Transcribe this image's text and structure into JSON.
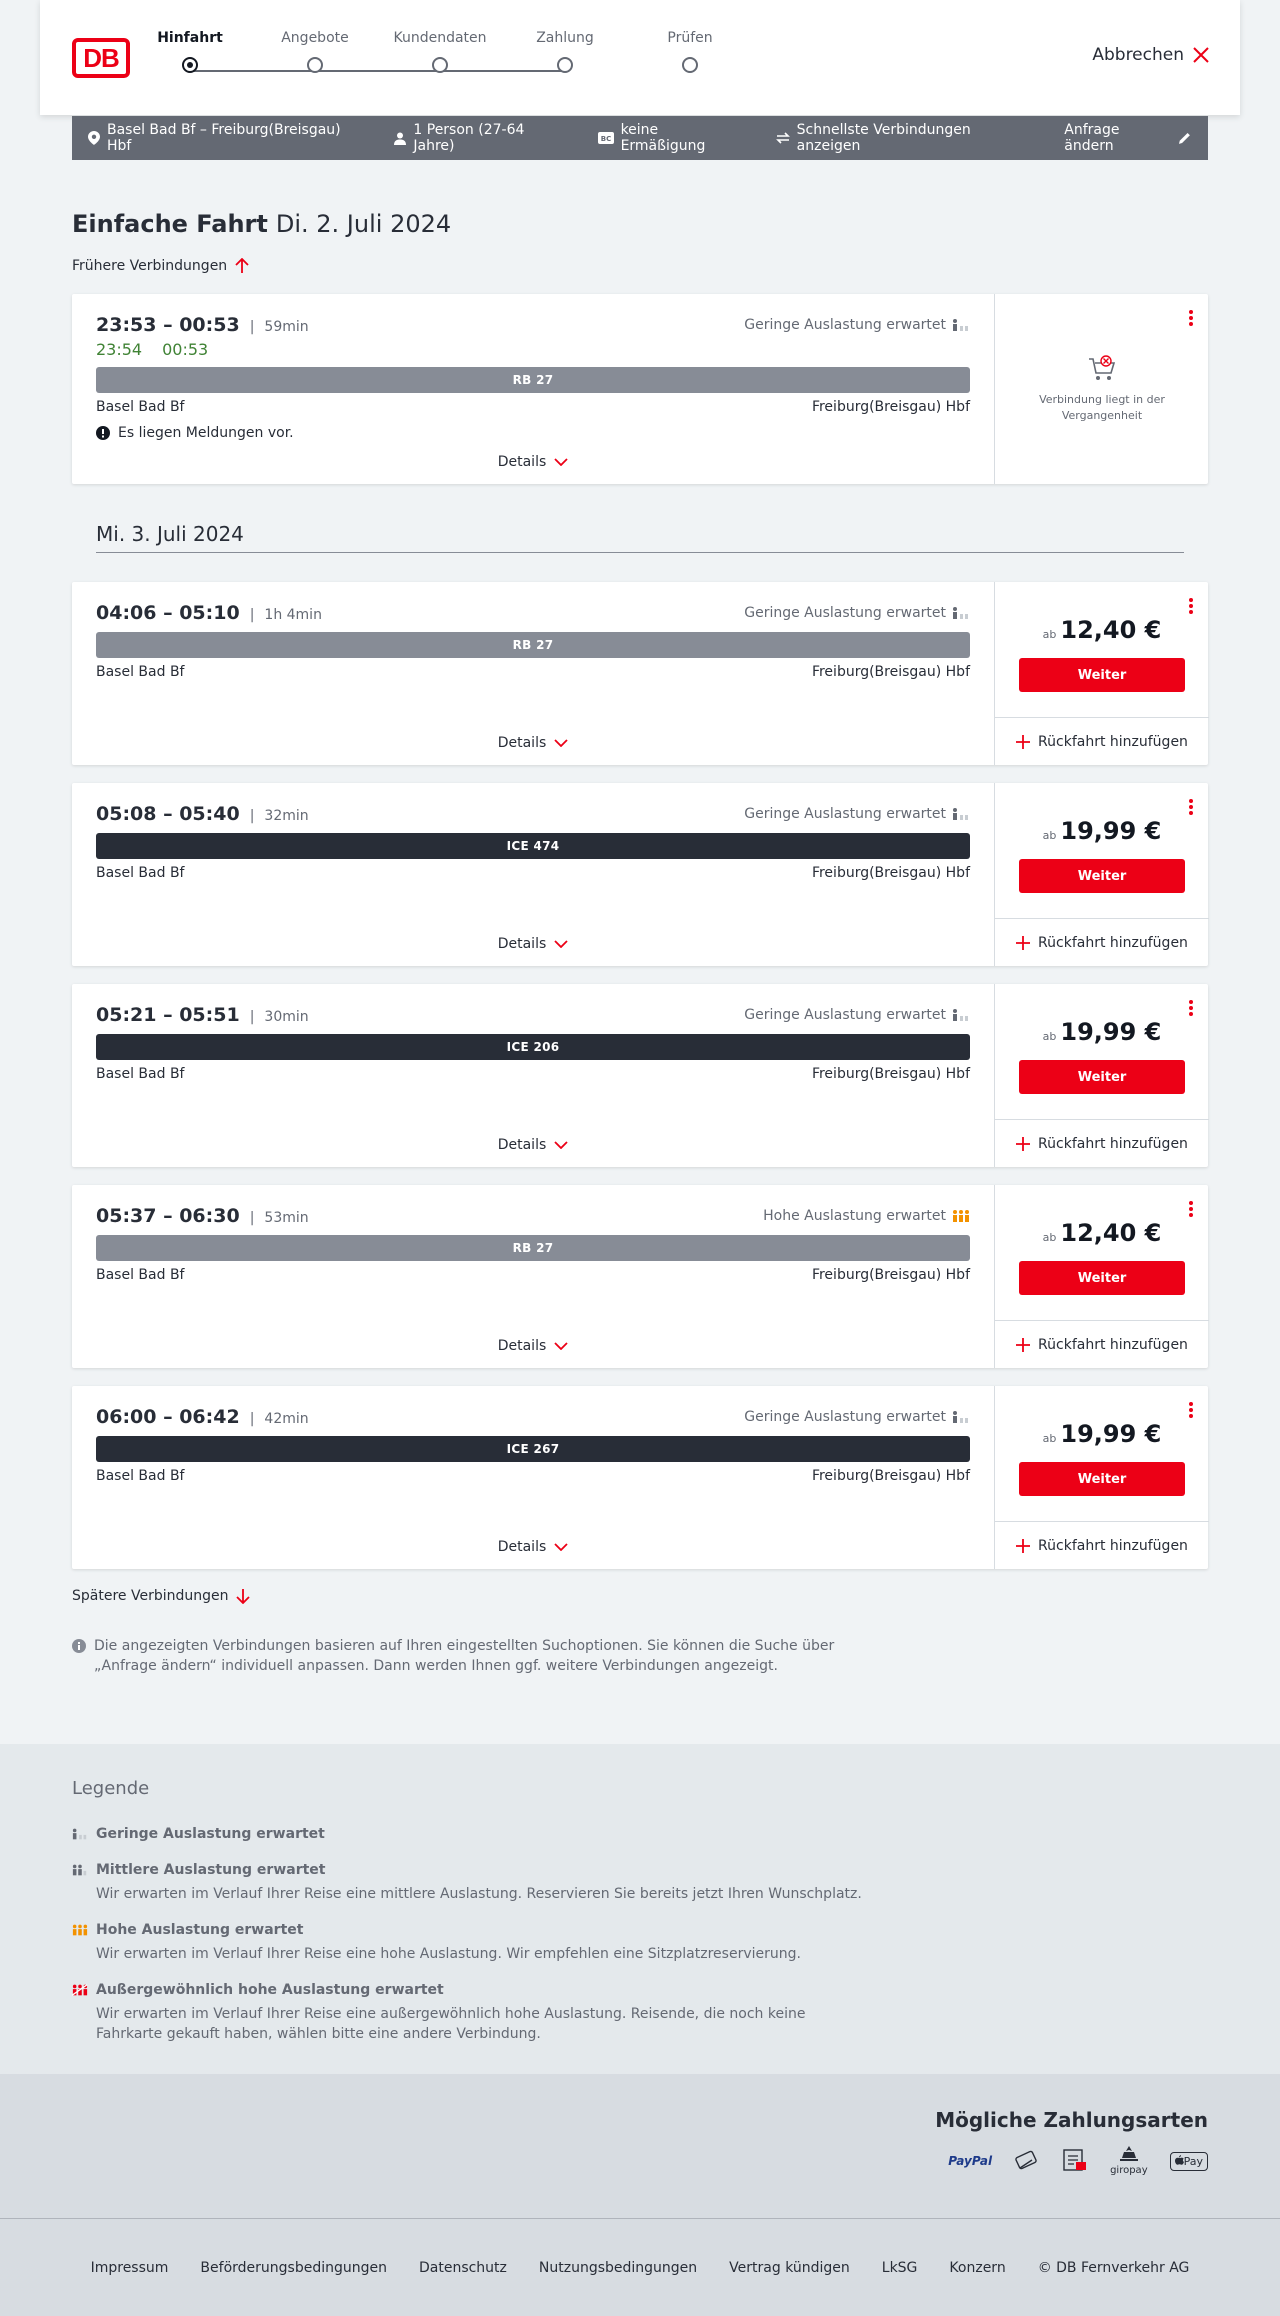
{
  "header": {
    "logo_text": "DB",
    "steps": [
      {
        "label": "Hinfahrt",
        "active": true
      },
      {
        "label": "Angebote",
        "active": false
      },
      {
        "label": "Kundendaten",
        "active": false
      },
      {
        "label": "Zahlung",
        "active": false
      },
      {
        "label": "Prüfen",
        "active": false
      }
    ],
    "cancel_label": "Abbrechen"
  },
  "summary": {
    "route": "Basel Bad Bf – Freiburg(Breisgau) Hbf",
    "passengers": "1 Person (27-64 Jahre)",
    "discount": "keine Ermäßigung",
    "fastest": "Schnellste Verbindungen anzeigen",
    "edit": "Anfrage ändern"
  },
  "title": {
    "main": "Einfache Fahrt",
    "date": "Di. 2. Juli 2024"
  },
  "earlier_label": "Frühere Verbindungen",
  "later_label": "Spätere Verbindungen",
  "day2_heading": "Mi. 3. Juli 2024",
  "connections": [
    {
      "times": "23:53 – 00:53",
      "duration": "59min",
      "realtime_dep": "23:54",
      "realtime_arr": "00:53",
      "load": "Geringe Auslastung erwartet",
      "load_level": "low",
      "train": "RB 27",
      "train_type": "regional",
      "from": "Basel Bad Bf",
      "to": "Freiburg(Breisgau) Hbf",
      "notice": "Es liegen Meldungen vor.",
      "past_msg": "Verbindung liegt in der Vergangenheit",
      "details": "Details"
    },
    {
      "times": "04:06 – 05:10",
      "duration": "1h 4min",
      "load": "Geringe Auslastung erwartet",
      "load_level": "low",
      "train": "RB 27",
      "train_type": "regional",
      "from": "Basel Bad Bf",
      "to": "Freiburg(Breisgau) Hbf",
      "price_prefix": "ab",
      "price": "12,40 €",
      "button": "Weiter",
      "return": "Rückfahrt hinzufügen",
      "details": "Details"
    },
    {
      "times": "05:08 – 05:40",
      "duration": "32min",
      "load": "Geringe Auslastung erwartet",
      "load_level": "low",
      "train": "ICE 474",
      "train_type": "ice",
      "from": "Basel Bad Bf",
      "to": "Freiburg(Breisgau) Hbf",
      "price_prefix": "ab",
      "price": "19,99 €",
      "button": "Weiter",
      "return": "Rückfahrt hinzufügen",
      "details": "Details"
    },
    {
      "times": "05:21 – 05:51",
      "duration": "30min",
      "load": "Geringe Auslastung erwartet",
      "load_level": "low",
      "train": "ICE 206",
      "train_type": "ice",
      "from": "Basel Bad Bf",
      "to": "Freiburg(Breisgau) Hbf",
      "price_prefix": "ab",
      "price": "19,99 €",
      "button": "Weiter",
      "return": "Rückfahrt hinzufügen",
      "details": "Details"
    },
    {
      "times": "05:37 – 06:30",
      "duration": "53min",
      "load": "Hohe Auslastung erwartet",
      "load_level": "high",
      "train": "RB 27",
      "train_type": "regional",
      "from": "Basel Bad Bf",
      "to": "Freiburg(Breisgau) Hbf",
      "price_prefix": "ab",
      "price": "12,40 €",
      "button": "Weiter",
      "return": "Rückfahrt hinzufügen",
      "details": "Details"
    },
    {
      "times": "06:00 – 06:42",
      "duration": "42min",
      "load": "Geringe Auslastung erwartet",
      "load_level": "low",
      "train": "ICE 267",
      "train_type": "ice",
      "from": "Basel Bad Bf",
      "to": "Freiburg(Breisgau) Hbf",
      "price_prefix": "ab",
      "price": "19,99 €",
      "button": "Weiter",
      "return": "Rückfahrt hinzufügen",
      "details": "Details"
    }
  ],
  "info_text": "Die angezeigten Verbindungen basieren auf Ihren eingestellten Suchoptionen. Sie können die Suche über „Anfrage ändern“ individuell anpassen. Dann werden Ihnen ggf. weitere Verbindungen angezeigt.",
  "legend": {
    "title": "Legende",
    "items": [
      {
        "heading": "Geringe Auslastung erwartet",
        "text": "",
        "level": "low"
      },
      {
        "heading": "Mittlere Auslastung erwartet",
        "text": "Wir erwarten im Verlauf Ihrer Reise eine mittlere Auslastung. Reservieren Sie bereits jetzt Ihren Wunschplatz.",
        "level": "medium"
      },
      {
        "heading": "Hohe Auslastung erwartet",
        "text": "Wir erwarten im Verlauf Ihrer Reise eine hohe Auslastung. Wir empfehlen eine Sitzplatzreservierung.",
        "level": "high"
      },
      {
        "heading": "Außergewöhnlich hohe Auslastung erwartet",
        "text": "Wir erwarten im Verlauf Ihrer Reise eine außergewöhnlich hohe Auslastung. Reisende, die noch keine Fahrkarte gekauft haben, wählen bitte eine andere Verbindung.",
        "level": "extreme"
      }
    ]
  },
  "payment": {
    "title": "Mögliche Zahlungsarten",
    "methods": [
      {
        "name": "paypal-icon",
        "label": "PayPal"
      },
      {
        "name": "credit-card-icon",
        "label": ""
      },
      {
        "name": "sepa-icon",
        "label": "SEPA"
      },
      {
        "name": "giropay-icon",
        "label": "giropay"
      },
      {
        "name": "apple-pay-icon",
        "label": "Pay"
      }
    ]
  },
  "footer": {
    "links": [
      "Impressum",
      "Beförderungsbedingungen",
      "Datenschutz",
      "Nutzungsbedingungen",
      "Vertrag kündigen",
      "LkSG",
      "Konzern",
      "© DB Fernverkehr AG"
    ]
  },
  "colors": {
    "brand_red": "#ec0016",
    "realtime_green": "#408335",
    "load_high": "#f39200",
    "dark": "#282d37"
  }
}
